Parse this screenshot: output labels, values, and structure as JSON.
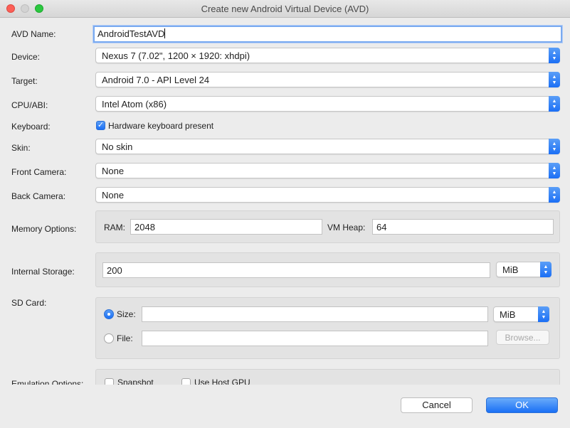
{
  "window": {
    "title": "Create new Android Virtual Device (AVD)"
  },
  "fields": {
    "avd_name": {
      "label": "AVD Name:",
      "value": "AndroidTestAVD"
    },
    "device": {
      "label": "Device:",
      "value": "Nexus 7 (7.02\", 1200 × 1920: xhdpi)"
    },
    "target": {
      "label": "Target:",
      "value": "Android 7.0 - API Level 24"
    },
    "cpu_abi": {
      "label": "CPU/ABI:",
      "value": "Intel Atom (x86)"
    },
    "keyboard": {
      "label": "Keyboard:",
      "checkbox_label": "Hardware keyboard present",
      "checked": true
    },
    "skin": {
      "label": "Skin:",
      "value": "No skin"
    },
    "front_camera": {
      "label": "Front Camera:",
      "value": "None"
    },
    "back_camera": {
      "label": "Back Camera:",
      "value": "None"
    }
  },
  "memory": {
    "label": "Memory Options:",
    "ram_label": "RAM:",
    "ram_value": "2048",
    "vm_heap_label": "VM Heap:",
    "vm_heap_value": "64"
  },
  "internal_storage": {
    "label": "Internal Storage:",
    "value": "200",
    "unit": "MiB"
  },
  "sd_card": {
    "label": "SD Card:",
    "size_label": "Size:",
    "size_value": "",
    "size_unit": "MiB",
    "size_selected": true,
    "file_label": "File:",
    "file_value": "",
    "browse_label": "Browse..."
  },
  "emulation": {
    "label": "Emulation Options:",
    "snapshot_label": "Snapshot",
    "host_gpu_label": "Use Host GPU"
  },
  "buttons": {
    "cancel": "Cancel",
    "ok": "OK"
  },
  "colors": {
    "accent": "#1b6ff5",
    "background": "#ececec"
  },
  "icons": {
    "dropdown": "chevron-updown-icon",
    "check": "checkmark-icon"
  }
}
